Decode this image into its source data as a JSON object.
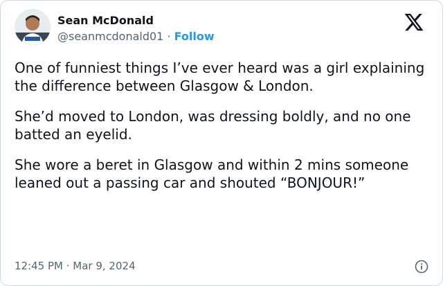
{
  "author": {
    "display_name": "Sean McDonald",
    "handle": "@seanmcdonald01",
    "separator": "·",
    "follow_label": "Follow",
    "avatar_icon": "profile-photo"
  },
  "platform_icon": "x-logo-icon",
  "tweet": {
    "paragraphs": [
      "One of funniest things I’ve ever heard was a girl explaining the difference between Glasgow & London.",
      "She’d moved to London, was dressing boldly, and no one batted an eyelid.",
      "She wore a beret in Glasgow and within 2 mins someone leaned out a passing car and shouted “BONJOUR!”"
    ]
  },
  "meta": {
    "timestamp": "12:45 PM · Mar 9, 2024",
    "info_icon": "info-icon"
  },
  "colors": {
    "accent": "#1d9bf0",
    "text": "#0f1419",
    "secondary": "#536471",
    "border": "#cfd9de"
  }
}
